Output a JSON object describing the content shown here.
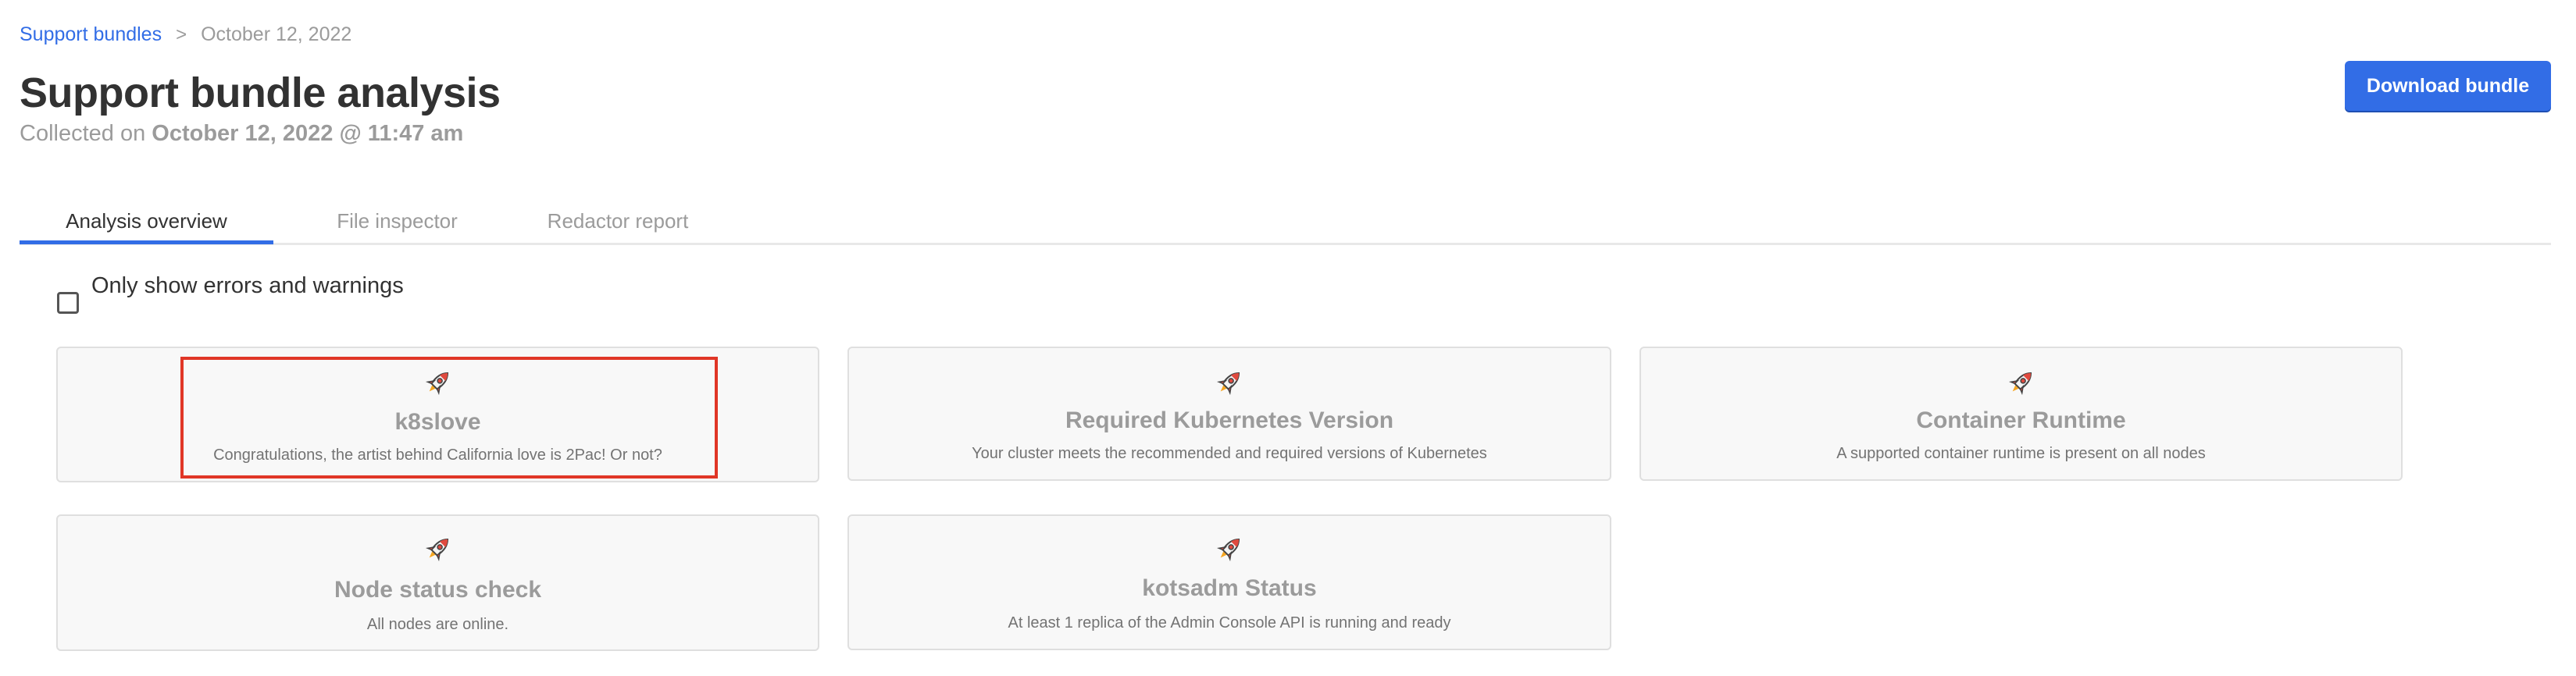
{
  "breadcrumb": {
    "root": "Support bundles",
    "separator": ">",
    "current": "October 12, 2022"
  },
  "header": {
    "title": "Support bundle analysis",
    "collected_prefix": "Collected on",
    "collected_value": "October 12, 2022 @ 11:47 am",
    "download_label": "Download bundle"
  },
  "tabs": [
    {
      "label": "Analysis overview",
      "active": true
    },
    {
      "label": "File inspector",
      "active": false
    },
    {
      "label": "Redactor report",
      "active": false
    }
  ],
  "filter": {
    "label": "Only show errors and warnings",
    "checked": false
  },
  "cards": [
    {
      "icon": "rocket-icon",
      "title": "k8slove",
      "description": "Congratulations, the artist behind California love is 2Pac! Or not?",
      "highlighted": true
    },
    {
      "icon": "rocket-icon",
      "title": "Required Kubernetes Version",
      "description": "Your cluster meets the recommended and required versions of Kubernetes",
      "highlighted": false
    },
    {
      "icon": "rocket-icon",
      "title": "Container Runtime",
      "description": "A supported container runtime is present on all nodes",
      "highlighted": false
    },
    {
      "icon": "rocket-icon",
      "title": "Node status check",
      "description": "All nodes are online.",
      "highlighted": false
    },
    {
      "icon": "rocket-icon",
      "title": "kotsadm Status",
      "description": "At least 1 replica of the Admin Console API is running and ready",
      "highlighted": false
    }
  ],
  "colors": {
    "accent": "#326de6",
    "highlight": "#e03626",
    "card_bg": "#f8f8f8",
    "muted_text": "#9b9b9b"
  }
}
